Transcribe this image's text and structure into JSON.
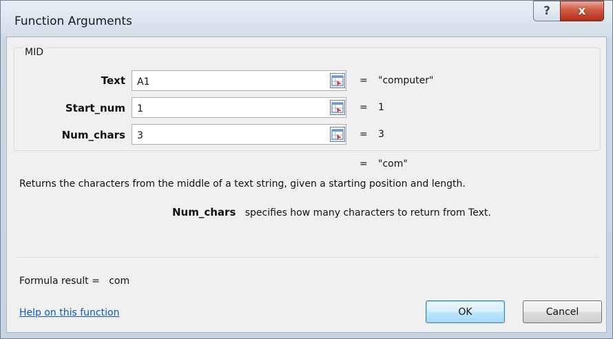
{
  "window": {
    "title": "Function Arguments",
    "help_button": "?",
    "close_button": "x"
  },
  "function": {
    "name": "MID",
    "arguments": [
      {
        "label": "Text",
        "value": "A1",
        "result": "\"computer\""
      },
      {
        "label": "Start_num",
        "value": "1",
        "result": "1"
      },
      {
        "label": "Num_chars",
        "value": "3",
        "result": "3"
      }
    ],
    "equals": "=",
    "overall_result": "\"com\"",
    "description": "Returns the characters from the middle of a text string, given a starting position and length.",
    "param_help_name": "Num_chars",
    "param_help_text": "specifies how many characters to return from Text."
  },
  "footer": {
    "formula_result_label": "Formula result =",
    "formula_result_value": "com",
    "help_link": "Help on this function",
    "ok_label": "OK",
    "cancel_label": "Cancel"
  },
  "colors": {
    "link": "#0b56c9",
    "close_button": "#c4432a",
    "ok_button_border": "#3c7fb1"
  }
}
